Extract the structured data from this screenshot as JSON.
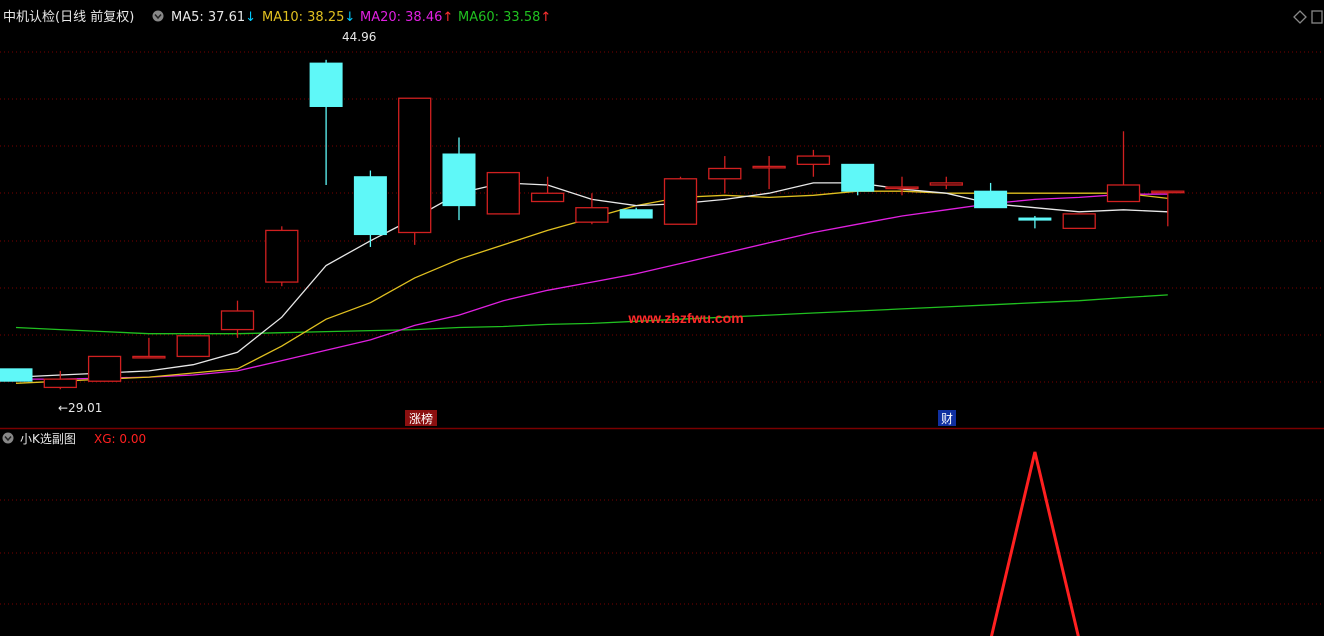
{
  "header": {
    "title": "中机认检(日线 前复权)",
    "ma": [
      {
        "label": "MA5: 37.61",
        "arrow": "↓",
        "arrow_color": "#00ccff",
        "color": "#e8e8e8"
      },
      {
        "label": "MA10: 38.25",
        "arrow": "↓",
        "arrow_color": "#00ccff",
        "color": "#e0c020"
      },
      {
        "label": "MA20: 38.46",
        "arrow": "↑",
        "arrow_color": "#ff3030",
        "color": "#e020e0"
      },
      {
        "label": "MA60: 33.58",
        "arrow": "↑",
        "arrow_color": "#ff3030",
        "color": "#20c020"
      }
    ]
  },
  "sub_header": {
    "title": "小K选副图",
    "xg_label": "XG: 0.00"
  },
  "annotations": {
    "high": "44.96",
    "low": "←29.01",
    "markers": [
      {
        "text": "涨榜",
        "bg": "#8b1010",
        "color": "#ffffff",
        "index": 9
      },
      {
        "text": "财",
        "bg": "#1030a0",
        "color": "#ffffff",
        "index": 21
      }
    ],
    "watermark": "www.zbzfwu.com"
  },
  "colors": {
    "up": "#d02020",
    "down": "#5ff8f8",
    "grid": "#7a0000",
    "signal": "#ff2020"
  },
  "chart_data": {
    "type": "candlestick",
    "price_range": [
      28.2,
      46.5
    ],
    "candles": [
      {
        "o": 30.0,
        "h": 30.0,
        "l": 29.4,
        "c": 29.4
      },
      {
        "o": 29.1,
        "h": 29.9,
        "l": 29.01,
        "c": 29.5
      },
      {
        "o": 29.4,
        "h": 30.6,
        "l": 29.4,
        "c": 30.6
      },
      {
        "o": 30.6,
        "h": 31.5,
        "l": 30.6,
        "c": 30.6
      },
      {
        "o": 30.6,
        "h": 31.6,
        "l": 30.6,
        "c": 31.6
      },
      {
        "o": 31.9,
        "h": 33.3,
        "l": 31.5,
        "c": 32.8
      },
      {
        "o": 34.2,
        "h": 36.9,
        "l": 34.0,
        "c": 36.7
      },
      {
        "o": 44.8,
        "h": 44.96,
        "l": 38.9,
        "c": 42.7
      },
      {
        "o": 39.3,
        "h": 39.6,
        "l": 35.9,
        "c": 36.5
      },
      {
        "o": 36.6,
        "h": 43.1,
        "l": 36.0,
        "c": 43.1
      },
      {
        "o": 40.4,
        "h": 41.2,
        "l": 37.2,
        "c": 37.9
      },
      {
        "o": 37.5,
        "h": 39.5,
        "l": 37.5,
        "c": 39.5
      },
      {
        "o": 38.1,
        "h": 39.3,
        "l": 38.1,
        "c": 38.5
      },
      {
        "o": 37.1,
        "h": 38.5,
        "l": 37.0,
        "c": 37.8
      },
      {
        "o": 37.7,
        "h": 37.8,
        "l": 37.3,
        "c": 37.3
      },
      {
        "o": 37.0,
        "h": 39.3,
        "l": 37.0,
        "c": 39.2
      },
      {
        "o": 39.2,
        "h": 40.3,
        "l": 38.5,
        "c": 39.7
      },
      {
        "o": 39.8,
        "h": 40.3,
        "l": 38.7,
        "c": 39.8
      },
      {
        "o": 39.9,
        "h": 40.6,
        "l": 39.3,
        "c": 40.3
      },
      {
        "o": 39.9,
        "h": 39.9,
        "l": 38.4,
        "c": 38.6
      },
      {
        "o": 38.8,
        "h": 39.3,
        "l": 38.4,
        "c": 38.8
      },
      {
        "o": 38.9,
        "h": 39.3,
        "l": 38.7,
        "c": 39.0
      },
      {
        "o": 38.6,
        "h": 39.0,
        "l": 37.8,
        "c": 37.8
      },
      {
        "o": 37.3,
        "h": 37.4,
        "l": 36.8,
        "c": 37.2
      },
      {
        "o": 36.8,
        "h": 36.8,
        "l": 36.8,
        "c": 37.5
      },
      {
        "o": 38.1,
        "h": 41.5,
        "l": 38.1,
        "c": 38.9
      },
      {
        "o": 38.6,
        "h": 38.6,
        "l": 36.9,
        "c": 38.6
      }
    ],
    "ma5": [
      29.6,
      29.7,
      29.8,
      29.9,
      30.2,
      30.8,
      32.5,
      35.0,
      36.2,
      37.3,
      38.5,
      39.0,
      38.9,
      38.2,
      37.9,
      38.0,
      38.2,
      38.5,
      39.0,
      39.0,
      38.7,
      38.5,
      38.0,
      37.8,
      37.6,
      37.7,
      37.6
    ],
    "ma10": [
      29.3,
      29.4,
      29.5,
      29.6,
      29.8,
      30.0,
      31.1,
      32.4,
      33.2,
      34.4,
      35.3,
      36.0,
      36.7,
      37.3,
      37.9,
      38.3,
      38.4,
      38.3,
      38.4,
      38.6,
      38.6,
      38.5,
      38.5,
      38.5,
      38.5,
      38.5,
      38.25
    ],
    "ma20": [
      29.5,
      29.5,
      29.55,
      29.6,
      29.7,
      29.9,
      30.4,
      30.9,
      31.4,
      32.1,
      32.6,
      33.3,
      33.8,
      34.2,
      34.6,
      35.1,
      35.6,
      36.1,
      36.6,
      37.0,
      37.4,
      37.7,
      38.0,
      38.2,
      38.3,
      38.45,
      38.46
    ],
    "ma60": [
      32.0,
      31.9,
      31.8,
      31.7,
      31.7,
      31.7,
      31.75,
      31.8,
      31.85,
      31.9,
      32.0,
      32.05,
      32.15,
      32.2,
      32.3,
      32.4,
      32.5,
      32.6,
      32.7,
      32.8,
      32.9,
      33.0,
      33.1,
      33.2,
      33.3,
      33.45,
      33.58
    ],
    "xg": [
      0,
      0,
      0,
      0,
      0,
      0,
      0,
      0,
      0,
      0,
      0,
      0,
      0,
      0,
      0,
      0,
      0,
      0,
      0,
      0,
      0,
      0,
      0,
      1,
      0,
      0,
      0
    ]
  }
}
